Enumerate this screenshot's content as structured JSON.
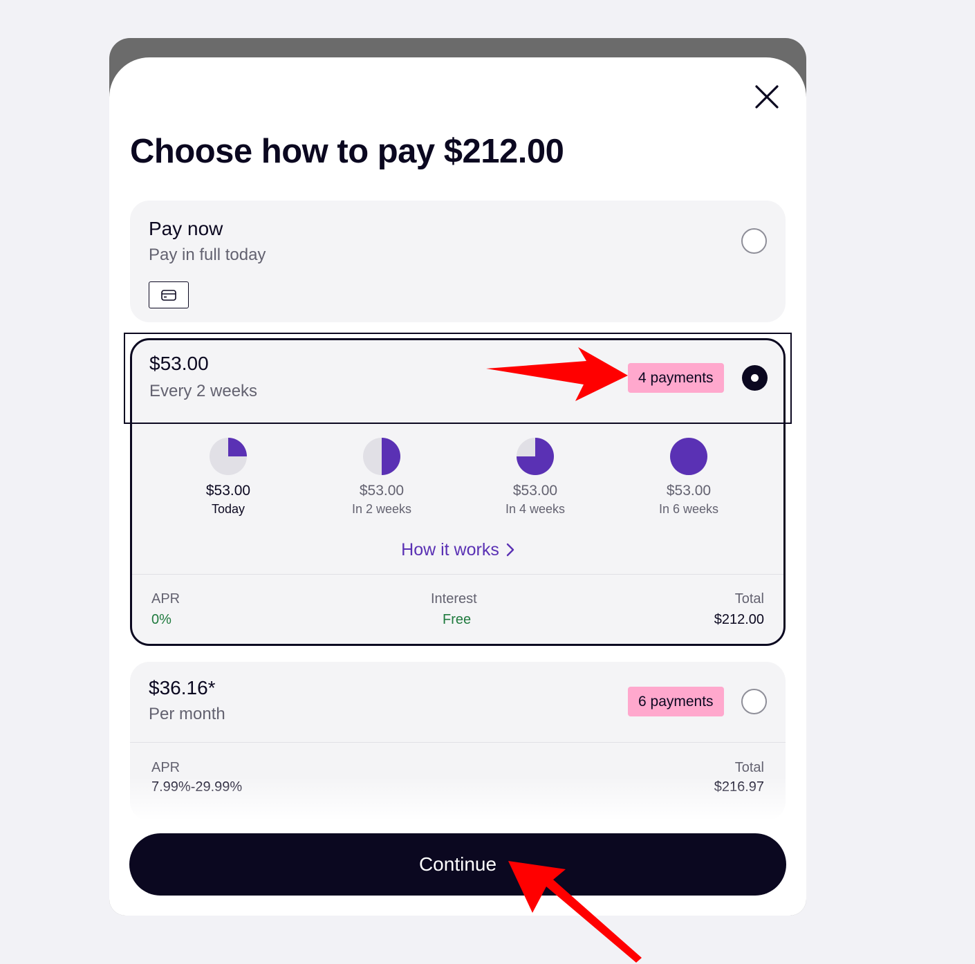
{
  "modal": {
    "title": "Choose how to pay $212.00",
    "close_icon": "close-icon"
  },
  "options": {
    "pay_now": {
      "title": "Pay now",
      "subtitle": "Pay in full today",
      "icon": "credit-card-icon",
      "selected": false
    },
    "four_payments": {
      "amount": "$53.00",
      "frequency": "Every 2 weeks",
      "badge": "4 payments",
      "selected": true,
      "schedule": [
        {
          "amount": "$53.00",
          "when": "Today",
          "fraction_paid": 0.25
        },
        {
          "amount": "$53.00",
          "when": "In 2 weeks",
          "fraction_paid": 0.5
        },
        {
          "amount": "$53.00",
          "when": "In 4 weeks",
          "fraction_paid": 0.75
        },
        {
          "amount": "$53.00",
          "when": "In 6 weeks",
          "fraction_paid": 1.0
        }
      ],
      "how_it_works": "How it works",
      "apr_label": "APR",
      "apr_value": "0%",
      "interest_label": "Interest",
      "interest_value": "Free",
      "total_label": "Total",
      "total_value": "$212.00"
    },
    "six_payments": {
      "amount": "$36.16*",
      "frequency": "Per month",
      "badge": "6 payments",
      "selected": false,
      "apr_label": "APR",
      "apr_value": "7.99%-29.99%",
      "total_label": "Total",
      "total_value": "$216.97"
    }
  },
  "actions": {
    "continue_label": "Continue"
  },
  "colors": {
    "primary": "#0b0820",
    "accent_purple": "#5a31b4",
    "badge_pink": "#ffa8cd",
    "annotation_red": "#ff0000",
    "positive_green": "#1f7a3e"
  }
}
